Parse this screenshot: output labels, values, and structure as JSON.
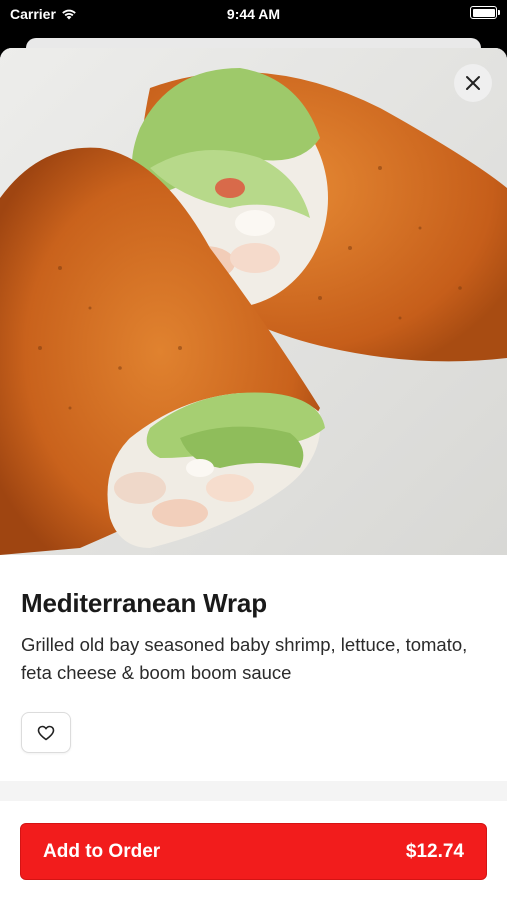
{
  "status_bar": {
    "carrier": "Carrier",
    "time": "9:44 AM"
  },
  "hero_image": {
    "subject": "wrap-photo"
  },
  "item": {
    "name": "Mediterranean Wrap",
    "description": "Grilled old bay seasoned baby shrimp, lettuce, tomato, feta cheese & boom boom sauce"
  },
  "actions": {
    "add_to_order_label": "Add to Order",
    "price": "$12.74"
  },
  "colors": {
    "accent": "#f21c1c",
    "text": "#1a1a1a"
  },
  "icons": {
    "close": "close-icon",
    "favorite": "heart-icon",
    "wifi": "wifi-icon",
    "battery": "battery-icon"
  }
}
